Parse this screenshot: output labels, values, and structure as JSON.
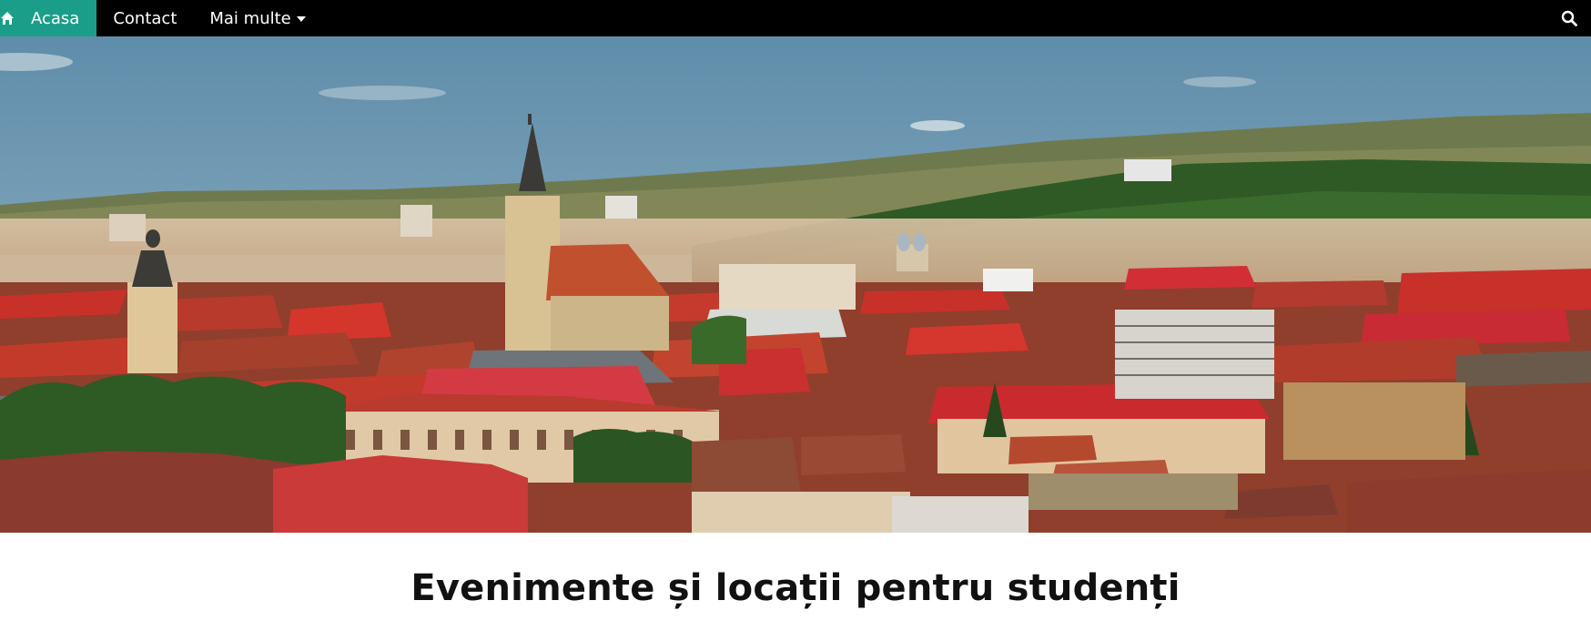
{
  "nav": {
    "items": [
      {
        "label": "Acasa",
        "icon": "home-icon",
        "active": true
      },
      {
        "label": "Contact",
        "active": false
      },
      {
        "label": "Mai multe",
        "icon": "caret-down-icon",
        "active": false
      }
    ],
    "search_icon": "search-icon"
  },
  "main": {
    "title": "Evenimente și locații pentru studenți"
  },
  "colors": {
    "nav_background": "#000000",
    "active_tab": "#1a9e8a",
    "roof_red": "#c8302a",
    "text": "#111111"
  }
}
